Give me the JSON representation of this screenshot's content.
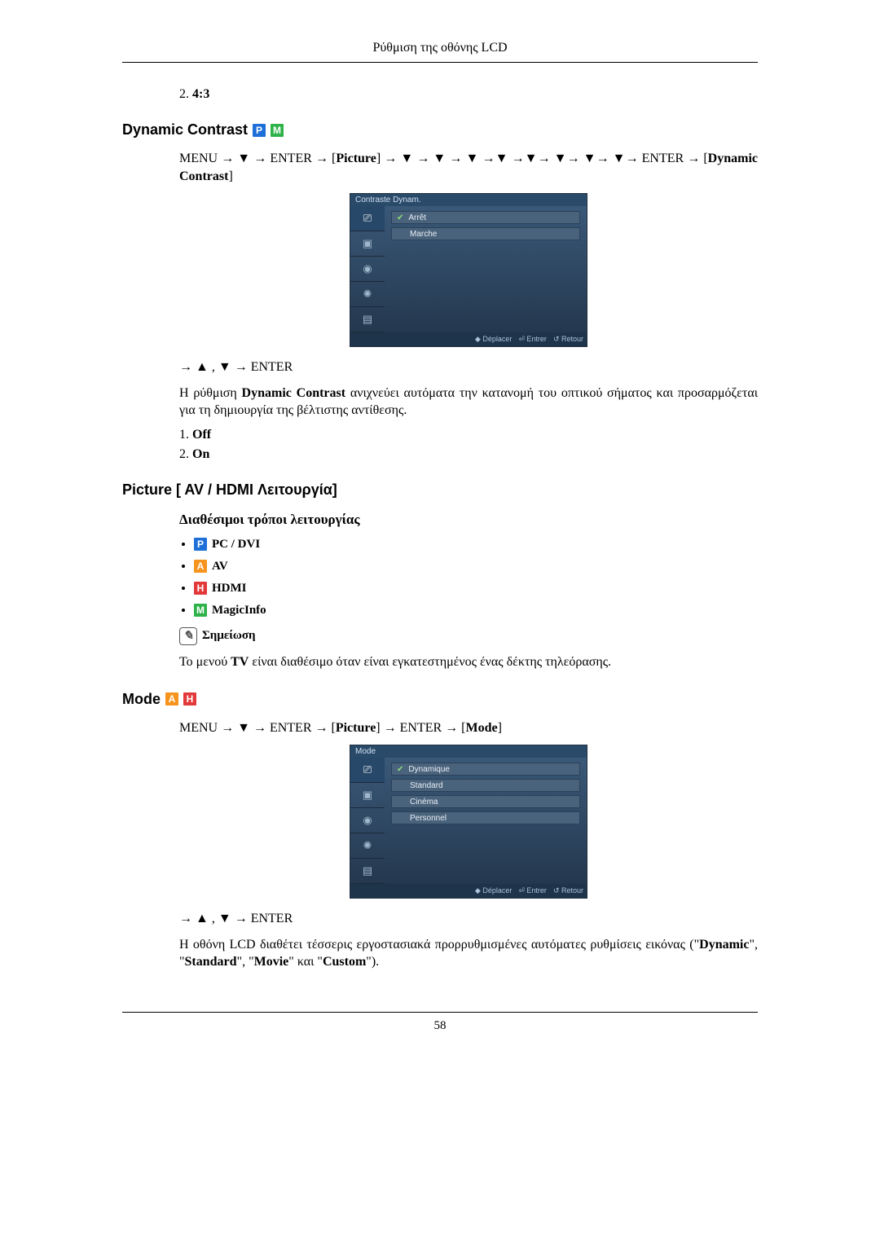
{
  "header": "Ρύθμιση της οθόνης LCD",
  "prev_item": {
    "num": "2.",
    "label": "4:3"
  },
  "dynamic": {
    "heading": "Dynamic Contrast",
    "nav1_a": "MENU → ",
    "nav1_b": " → ENTER → [",
    "picture": "Picture",
    "nav1_c": "] → ",
    "nav1_d": " → ",
    "nav1_e": " → ",
    "nav1_f": " →",
    "nav1_g": " →",
    "nav1_h": "→ ",
    "nav1_i": "→ ",
    "nav1_j": "→ ",
    "nav1_k": "→ ENTER → [",
    "dyn_label": "Dynamic Contrast",
    "nav1_l": "]",
    "osd_title": "Contraste Dynam.",
    "opts": [
      "Arrêt",
      "Marche"
    ],
    "foot": {
      "move": "Déplacer",
      "enter": "Entrer",
      "ret": "Retour"
    },
    "nav2_a": "→ ",
    "nav2_b": " , ",
    "nav2_c": " → ENTER",
    "desc_a": "Η ρύθμιση ",
    "desc_b": "Dynamic Contrast",
    "desc_c": " ανιχνεύει αυτόματα την κατανομή του οπτικού σήματος και προσαρμόζεται για τη δημιουργία της βέλτιστης αντίθεσης.",
    "items": [
      {
        "num": "1.",
        "label": "Off"
      },
      {
        "num": "2.",
        "label": "On"
      }
    ]
  },
  "pictureMode": {
    "heading": "Picture [ AV / HDMI Λειτουργία]",
    "sub": "Διαθέσιμοι τρόποι λειτουργίας",
    "modes": [
      {
        "badge": "P",
        "cls": "b-P",
        "label": "PC / DVI"
      },
      {
        "badge": "A",
        "cls": "b-A",
        "label": "AV"
      },
      {
        "badge": "H",
        "cls": "b-H",
        "label": "HDMI"
      },
      {
        "badge": "M",
        "cls": "b-M",
        "label": "MagicInfo"
      }
    ],
    "noteLabel": "Σημείωση",
    "note_a": "Το μενού ",
    "note_b": "TV",
    "note_c": " είναι διαθέσιμο όταν είναι εγκατεστημένος ένας δέκτης τηλεόρασης."
  },
  "mode": {
    "heading": "Mode",
    "nav_a": "MENU → ",
    "nav_b": " → ENTER → [",
    "nav_c": "Picture",
    "nav_d": "] → ENTER → [",
    "nav_e": "Mode",
    "nav_f": "]",
    "osd_title": "Mode",
    "opts": [
      "Dynamique",
      "Standard",
      "Cinéma",
      "Personnel"
    ],
    "foot": {
      "move": "Déplacer",
      "enter": "Entrer",
      "ret": "Retour"
    },
    "nav2_a": "→ ",
    "nav2_b": " , ",
    "nav2_c": " → ENTER",
    "desc_a": "Η οθόνη LCD διαθέτει τέσσερις εργοστασιακά προρρυθμισμένες αυτόματες ρυθμίσεις εικόνας (\"",
    "d1": "Dynamic",
    "s1": "\", \"",
    "d2": "Standard",
    "s2": "\", \"",
    "d3": "Movie",
    "s3": "\" και \"",
    "d4": "Custom",
    "s4": "\")."
  },
  "page_number": "58"
}
